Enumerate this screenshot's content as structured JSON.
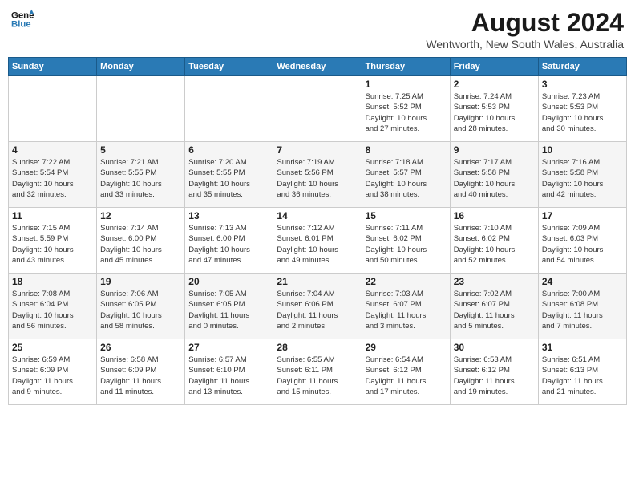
{
  "header": {
    "logo_line1": "General",
    "logo_line2": "Blue",
    "month_year": "August 2024",
    "location": "Wentworth, New South Wales, Australia"
  },
  "weekdays": [
    "Sunday",
    "Monday",
    "Tuesday",
    "Wednesday",
    "Thursday",
    "Friday",
    "Saturday"
  ],
  "weeks": [
    [
      {
        "day": "",
        "info": ""
      },
      {
        "day": "",
        "info": ""
      },
      {
        "day": "",
        "info": ""
      },
      {
        "day": "",
        "info": ""
      },
      {
        "day": "1",
        "info": "Sunrise: 7:25 AM\nSunset: 5:52 PM\nDaylight: 10 hours\nand 27 minutes."
      },
      {
        "day": "2",
        "info": "Sunrise: 7:24 AM\nSunset: 5:53 PM\nDaylight: 10 hours\nand 28 minutes."
      },
      {
        "day": "3",
        "info": "Sunrise: 7:23 AM\nSunset: 5:53 PM\nDaylight: 10 hours\nand 30 minutes."
      }
    ],
    [
      {
        "day": "4",
        "info": "Sunrise: 7:22 AM\nSunset: 5:54 PM\nDaylight: 10 hours\nand 32 minutes."
      },
      {
        "day": "5",
        "info": "Sunrise: 7:21 AM\nSunset: 5:55 PM\nDaylight: 10 hours\nand 33 minutes."
      },
      {
        "day": "6",
        "info": "Sunrise: 7:20 AM\nSunset: 5:55 PM\nDaylight: 10 hours\nand 35 minutes."
      },
      {
        "day": "7",
        "info": "Sunrise: 7:19 AM\nSunset: 5:56 PM\nDaylight: 10 hours\nand 36 minutes."
      },
      {
        "day": "8",
        "info": "Sunrise: 7:18 AM\nSunset: 5:57 PM\nDaylight: 10 hours\nand 38 minutes."
      },
      {
        "day": "9",
        "info": "Sunrise: 7:17 AM\nSunset: 5:58 PM\nDaylight: 10 hours\nand 40 minutes."
      },
      {
        "day": "10",
        "info": "Sunrise: 7:16 AM\nSunset: 5:58 PM\nDaylight: 10 hours\nand 42 minutes."
      }
    ],
    [
      {
        "day": "11",
        "info": "Sunrise: 7:15 AM\nSunset: 5:59 PM\nDaylight: 10 hours\nand 43 minutes."
      },
      {
        "day": "12",
        "info": "Sunrise: 7:14 AM\nSunset: 6:00 PM\nDaylight: 10 hours\nand 45 minutes."
      },
      {
        "day": "13",
        "info": "Sunrise: 7:13 AM\nSunset: 6:00 PM\nDaylight: 10 hours\nand 47 minutes."
      },
      {
        "day": "14",
        "info": "Sunrise: 7:12 AM\nSunset: 6:01 PM\nDaylight: 10 hours\nand 49 minutes."
      },
      {
        "day": "15",
        "info": "Sunrise: 7:11 AM\nSunset: 6:02 PM\nDaylight: 10 hours\nand 50 minutes."
      },
      {
        "day": "16",
        "info": "Sunrise: 7:10 AM\nSunset: 6:02 PM\nDaylight: 10 hours\nand 52 minutes."
      },
      {
        "day": "17",
        "info": "Sunrise: 7:09 AM\nSunset: 6:03 PM\nDaylight: 10 hours\nand 54 minutes."
      }
    ],
    [
      {
        "day": "18",
        "info": "Sunrise: 7:08 AM\nSunset: 6:04 PM\nDaylight: 10 hours\nand 56 minutes."
      },
      {
        "day": "19",
        "info": "Sunrise: 7:06 AM\nSunset: 6:05 PM\nDaylight: 10 hours\nand 58 minutes."
      },
      {
        "day": "20",
        "info": "Sunrise: 7:05 AM\nSunset: 6:05 PM\nDaylight: 11 hours\nand 0 minutes."
      },
      {
        "day": "21",
        "info": "Sunrise: 7:04 AM\nSunset: 6:06 PM\nDaylight: 11 hours\nand 2 minutes."
      },
      {
        "day": "22",
        "info": "Sunrise: 7:03 AM\nSunset: 6:07 PM\nDaylight: 11 hours\nand 3 minutes."
      },
      {
        "day": "23",
        "info": "Sunrise: 7:02 AM\nSunset: 6:07 PM\nDaylight: 11 hours\nand 5 minutes."
      },
      {
        "day": "24",
        "info": "Sunrise: 7:00 AM\nSunset: 6:08 PM\nDaylight: 11 hours\nand 7 minutes."
      }
    ],
    [
      {
        "day": "25",
        "info": "Sunrise: 6:59 AM\nSunset: 6:09 PM\nDaylight: 11 hours\nand 9 minutes."
      },
      {
        "day": "26",
        "info": "Sunrise: 6:58 AM\nSunset: 6:09 PM\nDaylight: 11 hours\nand 11 minutes."
      },
      {
        "day": "27",
        "info": "Sunrise: 6:57 AM\nSunset: 6:10 PM\nDaylight: 11 hours\nand 13 minutes."
      },
      {
        "day": "28",
        "info": "Sunrise: 6:55 AM\nSunset: 6:11 PM\nDaylight: 11 hours\nand 15 minutes."
      },
      {
        "day": "29",
        "info": "Sunrise: 6:54 AM\nSunset: 6:12 PM\nDaylight: 11 hours\nand 17 minutes."
      },
      {
        "day": "30",
        "info": "Sunrise: 6:53 AM\nSunset: 6:12 PM\nDaylight: 11 hours\nand 19 minutes."
      },
      {
        "day": "31",
        "info": "Sunrise: 6:51 AM\nSunset: 6:13 PM\nDaylight: 11 hours\nand 21 minutes."
      }
    ]
  ]
}
